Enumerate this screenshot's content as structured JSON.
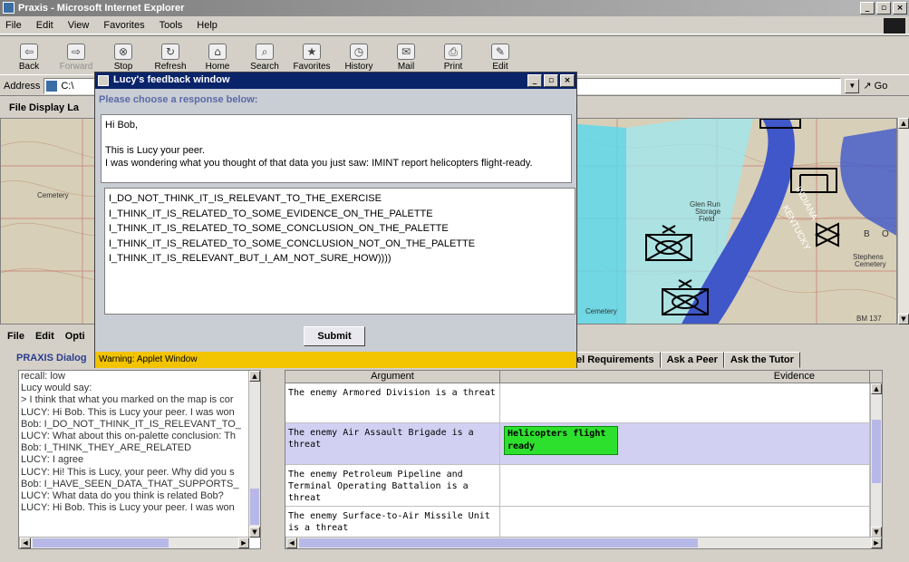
{
  "browser": {
    "title": "Praxis - Microsoft Internet Explorer",
    "menu": [
      "File",
      "Edit",
      "View",
      "Favorites",
      "Tools",
      "Help"
    ],
    "toolbar": [
      "Back",
      "Forward",
      "Stop",
      "Refresh",
      "Home",
      "Search",
      "Favorites",
      "History",
      "Mail",
      "Print",
      "Edit"
    ],
    "address_label": "Address",
    "address_value": "C:\\",
    "go_label": "Go"
  },
  "applet": {
    "menu_top": "File  Display La",
    "menu_lower": [
      "File",
      "Edit",
      "Opti"
    ],
    "praxis_label": "PRAXIS Dialog",
    "tabs": [
      "el Requirements",
      "Ask a Peer",
      "Ask the Tutor"
    ],
    "dialog_log": [
      "recall: low",
      "Lucy would say:",
      "> I think that what you marked on the map is cor",
      "LUCY: Hi Bob. This is Lucy your peer. I was won",
      "Bob: I_DO_NOT_THINK_IT_IS_RELEVANT_TO_",
      "LUCY: What about this on-palette conclusion: Th",
      "Bob: I_THINK_THEY_ARE_RELATED",
      "LUCY: I agree",
      "LUCY: Hi! This is Lucy, your peer. Why did you s",
      "Bob: I_HAVE_SEEN_DATA_THAT_SUPPORTS_",
      "LUCY: What data do you think is related Bob?",
      "LUCY: Hi Bob. This is Lucy your peer. I was won"
    ],
    "table": {
      "headers": [
        "Argument",
        "Evidence"
      ],
      "rows": [
        {
          "argument": "The enemy Armored Division is a threat",
          "evidence": ""
        },
        {
          "argument": "The enemy Air Assault Brigade is a threat",
          "evidence": "Helicopters flight ready"
        },
        {
          "argument": "The enemy Petroleum Pipeline and Terminal Operating Battalion is a threat",
          "evidence": ""
        },
        {
          "argument": "The enemy Surface-to-Air Missile Unit is a threat",
          "evidence": ""
        }
      ]
    },
    "map_labels": [
      "Cemetery",
      "Glen Run",
      "Storage",
      "Field",
      "INDIANA",
      "KENTUCKY",
      "Stephens",
      "Cemetery",
      "Cemetery",
      "BM 137",
      "B",
      "O"
    ]
  },
  "feedback": {
    "title": "Lucy's feedback window",
    "prompt": "Please choose a response below:",
    "message_lines": [
      "Hi Bob,",
      "",
      "This is Lucy your peer.",
      "I was wondering what you thought of that data you just saw: IMINT report helicopters flight-ready."
    ],
    "options": [
      "I_DO_NOT_THINK_IT_IS_RELEVANT_TO_THE_EXERCISE",
      "I_THINK_IT_IS_RELATED_TO_SOME_EVIDENCE_ON_THE_PALETTE",
      "I_THINK_IT_IS_RELATED_TO_SOME_CONCLUSION_ON_THE_PALETTE",
      "I_THINK_IT_IS_RELATED_TO_SOME_CONCLUSION_NOT_ON_THE_PALETTE",
      "I_THINK_IT_IS_RELEVANT_BUT_I_AM_NOT_SURE_HOW))))"
    ],
    "submit_label": "Submit",
    "warning": "Warning: Applet Window"
  },
  "colors": {
    "water": "#4ad8e8",
    "river": "#3f57c8",
    "selected_row": "#d2d0f2",
    "evidence_tag": "#2ee02e",
    "warning_bar": "#f2c400",
    "dialog_title": "#0a246a"
  }
}
